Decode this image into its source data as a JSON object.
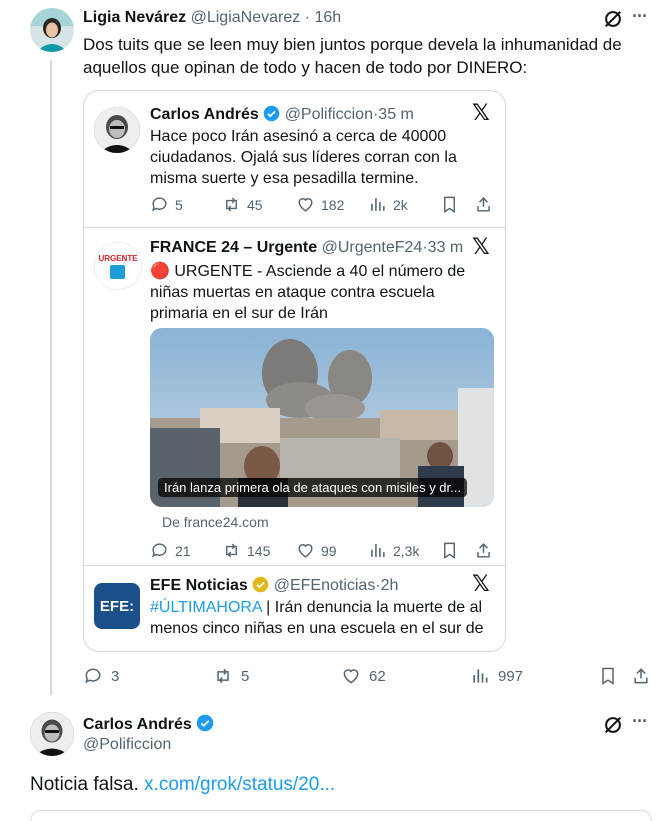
{
  "main_tweet": {
    "author_name": "Ligia Nevárez",
    "handle": "@LigiaNevarez",
    "sep": "·",
    "time": "16h",
    "text": "Dos tuits que se leen muy bien juntos porque devela la inhumanidad de aquellos que opinan de todo y hacen de todo por DINERO:",
    "more": "···",
    "stats": {
      "replies": "3",
      "reposts": "5",
      "likes": "62",
      "views": "997"
    }
  },
  "quote1": {
    "author_name": "Carlos Andrés",
    "handle": "@Polificcion",
    "time": "35 m",
    "text": "Hace poco Irán asesinó a cerca de 40000 ciudadanos. Ojalá sus líderes corran con la misma suerte y esa pesadilla termine.",
    "stats": {
      "replies": "5",
      "reposts": "45",
      "likes": "182",
      "views": "2k"
    }
  },
  "quote2": {
    "author_name": "FRANCE 24 – Urgente",
    "handle": "@UrgenteF24",
    "time": "33 m",
    "avatar_text": "URGENTE",
    "alert_emoji": "🔴",
    "text": " URGENTE - Asciende a 40 el número de niñas muertas en ataque contra escuela primaria en el sur de Irán",
    "image_caption": "Irán lanza primera ola de ataques con misiles y dr...",
    "link_source": "De france24.com",
    "stats": {
      "replies": "21",
      "reposts": "145",
      "likes": "99",
      "views": "2,3k"
    }
  },
  "quote3": {
    "author_name": "EFE Noticias",
    "handle": "@EFEnoticias",
    "time": "2h",
    "avatar_text": "EFE:",
    "hashtag": "#ÚLTIMAHORA",
    "text": " | Irán denuncia la muerte de al menos cinco niñas en una escuela en el sur de"
  },
  "reply": {
    "author_name": "Carlos Andrés",
    "handle": "@Polificcion",
    "text": "Noticia falsa. ",
    "link": "x.com/grok/status/20..."
  },
  "x_logo": "𝕏",
  "colors": {
    "accent": "#1d9bf0",
    "muted": "#536471",
    "border": "#cfd9de",
    "gold": "#e2b719",
    "alert_red": "#e0245e"
  }
}
